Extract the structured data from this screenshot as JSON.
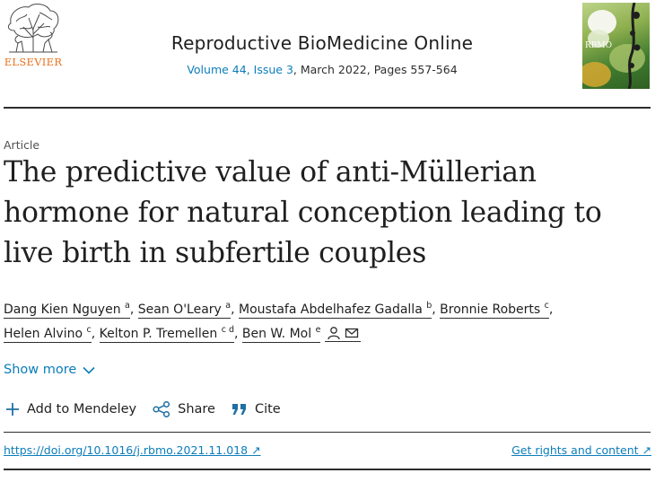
{
  "header": {
    "publisher": "ELSEVIER",
    "journal_title": "Reproductive BioMedicine Online",
    "volume_issue": "Volume 44, Issue 3",
    "issue_date_pages": ", March 2022, Pages 557-564",
    "cover_label": "RBMO"
  },
  "article": {
    "type": "Article",
    "title": "The predictive value of anti-Müllerian hormone for natural conception leading to live birth in subfertile couples"
  },
  "authors": [
    {
      "name": "Dang Kien Nguyen",
      "aff": "a"
    },
    {
      "name": "Sean O'Leary",
      "aff": "a"
    },
    {
      "name": "Moustafa Abdelhafez Gadalla",
      "aff": "b"
    },
    {
      "name": "Bronnie Roberts",
      "aff": "c"
    },
    {
      "name": "Helen Alvino",
      "aff": "c"
    },
    {
      "name": "Kelton P. Tremellen",
      "aff": "c d"
    },
    {
      "name": "Ben W. Mol",
      "aff": "e"
    }
  ],
  "show_more": "Show more",
  "actions": {
    "mendeley": "Add to Mendeley",
    "share": "Share",
    "cite": "Cite"
  },
  "links": {
    "doi": "https://doi.org/10.1016/j.rbmo.2021.11.018",
    "rights": "Get rights and content"
  },
  "colors": {
    "link": "#0c7dbb",
    "publisher_orange": "#e9711c",
    "text": "#1f1f1f"
  }
}
